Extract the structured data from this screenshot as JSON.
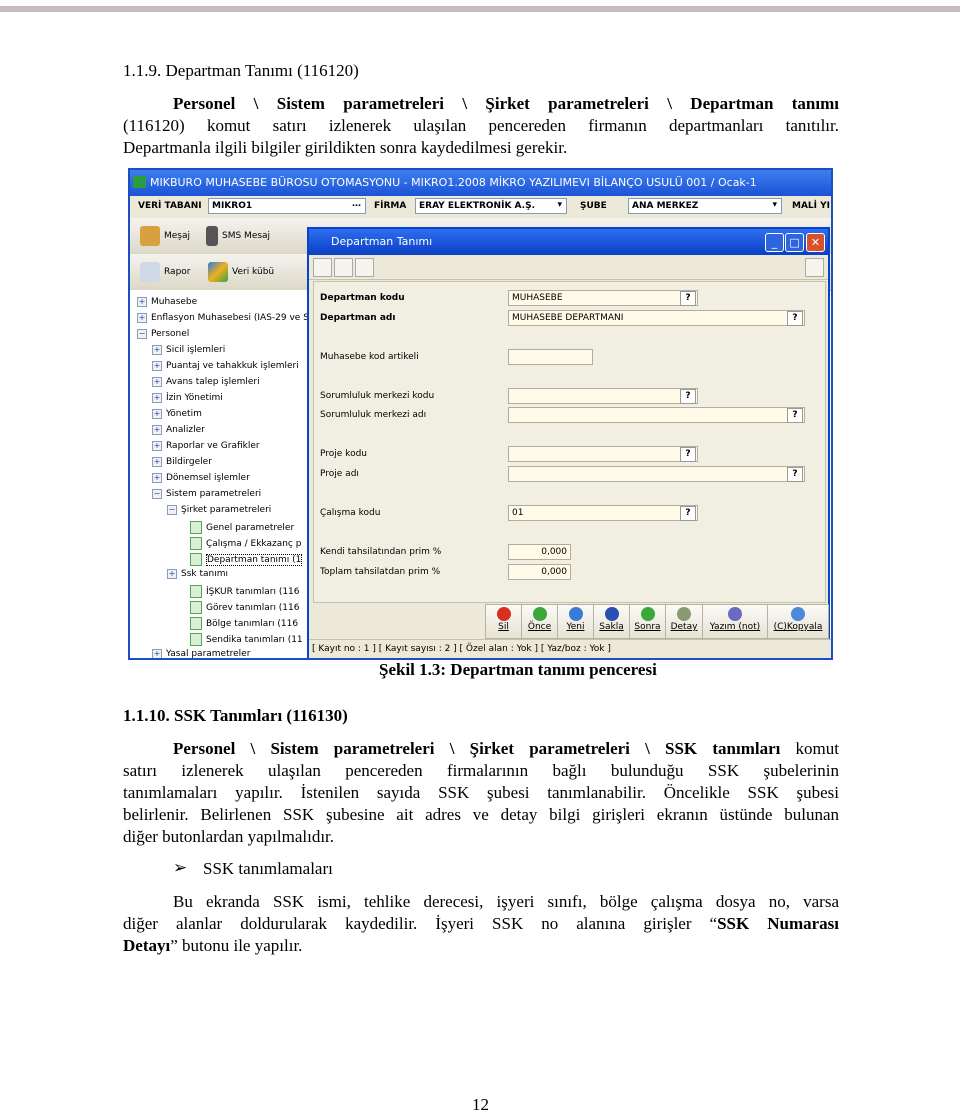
{
  "section1": {
    "heading": "1.1.9. Departman Tanımı (116120)",
    "para_bold": "Personel \\ Sistem parametreleri \\ Şirket parametreleri \\ Departman tanımı",
    "para_line1_rest": "",
    "para_line2": "(116120) komut satırı izlenerek ulaşılan pencereden firmanın departmanları tanıtılır.",
    "para_line3": "Departmanla ilgili bilgiler girildikten sonra kaydedilmesi gerekir."
  },
  "screenshot": {
    "app_title": "MIKBURO MUHASEBE BÜROSU OTOMASYONU - MIKRO1.2008 MİKRO YAZILIMEVI BİLANÇO USULÜ 001 / Ocak-1",
    "db_label": "VERİ TABANI",
    "db_value": "MIKRO1",
    "firm_label": "FİRMA",
    "firm_value": "ERAY ELEKTRONİK A.Ş.",
    "branch_label": "ŞUBE",
    "branch_value": "ANA MERKEZ",
    "fiscal_label": "MALİ YI",
    "toolbar": [
      "Meşaj",
      "SMS Mesaj",
      "Rapor",
      "Veri kübü"
    ],
    "tree": [
      {
        "label": "Muhasebe",
        "level": 0,
        "type": "plus"
      },
      {
        "label": "Enflasyon Muhasebesi (IAS-29 ve SP",
        "level": 0,
        "type": "plus"
      },
      {
        "label": "Personel",
        "level": 0,
        "type": "minus"
      },
      {
        "label": "Sicil işlemleri",
        "level": 1,
        "type": "plus"
      },
      {
        "label": "Puantaj ve tahakkuk işlemleri",
        "level": 1,
        "type": "plus"
      },
      {
        "label": "Avans talep işlemleri",
        "level": 1,
        "type": "plus"
      },
      {
        "label": "İzin Yönetimi",
        "level": 1,
        "type": "plus"
      },
      {
        "label": "Yönetim",
        "level": 1,
        "type": "plus"
      },
      {
        "label": "Analizler",
        "level": 1,
        "type": "plus"
      },
      {
        "label": "Raporlar ve Grafikler",
        "level": 1,
        "type": "plus"
      },
      {
        "label": "Bildirgeler",
        "level": 1,
        "type": "plus"
      },
      {
        "label": "Dönemsel işlemler",
        "level": 1,
        "type": "plus"
      },
      {
        "label": "Sistem parametreleri",
        "level": 1,
        "type": "minus"
      },
      {
        "label": "Şirket parametreleri",
        "level": 2,
        "type": "minus"
      },
      {
        "label": "Genel parametreler",
        "level": 3,
        "type": "leaf"
      },
      {
        "label": "Çalışma / Ekkazanç p",
        "level": 3,
        "type": "leaf"
      },
      {
        "label": "Departman tanımı (1",
        "level": 3,
        "type": "leaf",
        "selected": true
      },
      {
        "label": "Ssk tanımı",
        "level": 2,
        "type": "plus"
      },
      {
        "label": "İŞKUR tanımları (116",
        "level": 3,
        "type": "leaf"
      },
      {
        "label": "Görev tanımları (116",
        "level": 3,
        "type": "leaf"
      },
      {
        "label": "Bölge tanımları (116",
        "level": 3,
        "type": "leaf"
      },
      {
        "label": "Sendika tanımları (11",
        "level": 3,
        "type": "leaf"
      },
      {
        "label": "Yasal parametreler",
        "level": 1,
        "type": "plus"
      }
    ],
    "dialog": {
      "title": "Departman Tanımı",
      "fields": [
        {
          "label": "Departman kodu",
          "value": "MUHASEBE",
          "size": "mid",
          "help": "?"
        },
        {
          "label": "Departman adı",
          "value": "MUHASEBE DEPARTMANI",
          "size": "long",
          "help": "?"
        },
        {
          "label": "Muhasebe kod artikeli",
          "value": "",
          "size": "short",
          "help": ""
        },
        {
          "label": "Sorumluluk merkezi kodu",
          "value": "",
          "size": "mid",
          "help": "?"
        },
        {
          "label": "Sorumluluk merkezi adı",
          "value": "",
          "size": "long",
          "help": "?"
        },
        {
          "label": "Proje kodu",
          "value": "",
          "size": "mid",
          "help": "?"
        },
        {
          "label": "Proje adı",
          "value": "",
          "size": "long",
          "help": "?"
        },
        {
          "label": "Çalışma kodu",
          "value": "01",
          "size": "mid",
          "help": "?"
        },
        {
          "label": "Kendi tahsilatından prim %",
          "value": "0,000",
          "size": "num",
          "help": ""
        },
        {
          "label": "Toplam tahsilatdan prim %",
          "value": "0,000",
          "size": "num",
          "help": ""
        }
      ],
      "buttons": [
        "Sil",
        "Önce",
        "Yeni",
        "Sakla",
        "Sonra",
        "Detay",
        "Yazım (not)",
        "(C)Kopyala"
      ],
      "status": "[ Kayıt no : 1 ] [ Kayıt sayısı : 2 ] [ Özel alan : Yok ] [ Yaz/boz : Yok ]"
    }
  },
  "caption": "Şekil 1.3: Departman tanımı penceresi",
  "section2": {
    "heading": "1.1.10. SSK Tanımları (116130)",
    "line1_bold": "Personel \\ Sistem parametreleri \\ Şirket parametreleri \\ SSK tanımları",
    "line1_rest": " komut",
    "line2": "satırı izlenerek ulaşılan pencereden firmalarının bağlı bulunduğu SSK şubelerinin",
    "line3": "tanımlamaları yapılır. İstenilen sayıda SSK şubesi tanımlanabilir. Öncelikle SSK şubesi",
    "line4": "belirlenir. Belirlenen SSK şubesine ait adres ve detay bilgi girişleri ekranın üstünde bulunan",
    "line5": "diğer butonlardan yapılmalıdır.",
    "bullet": "SSK tanımlamaları",
    "p2_line1": "Bu ekranda SSK ismi, tehlike derecesi, işyeri sınıfı, bölge çalışma dosya no, varsa",
    "p2_line2_a": "diğer alanlar doldurularak kaydedilir.  İşyeri SSK no alanına girişler “",
    "p2_line2_b": "SSK Numarası",
    "p2_line3_b": "Detayı",
    "p2_line3_rest": "” butonu ile yapılır."
  },
  "page_number": "12"
}
